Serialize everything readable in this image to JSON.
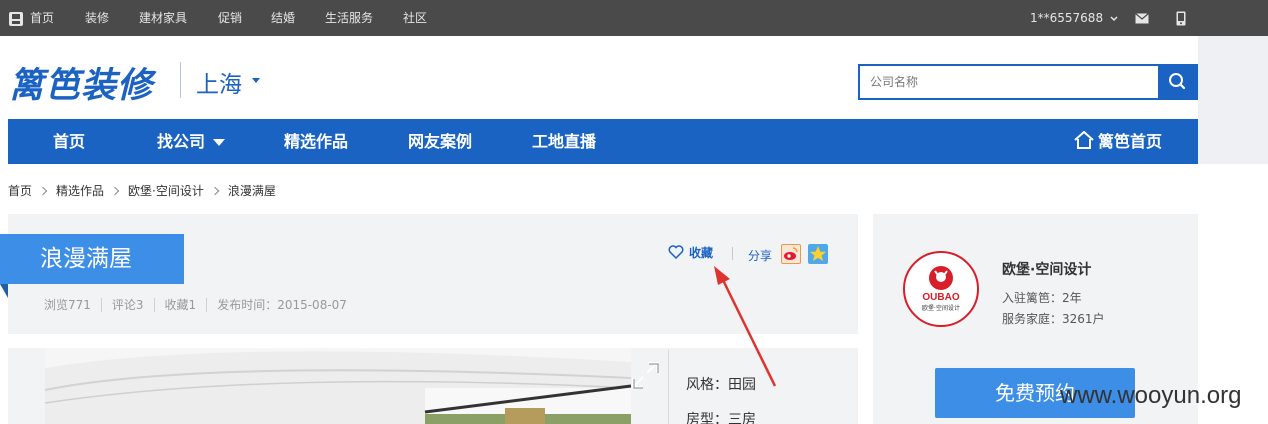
{
  "topbar": {
    "home": "首页",
    "links": [
      "装修",
      "建材家具",
      "促销",
      "结婚",
      "生活服务",
      "社区"
    ],
    "user": "1**6557688"
  },
  "header": {
    "logo": "篱笆装修",
    "city": "上海"
  },
  "search": {
    "placeholder": "公司名称"
  },
  "nav": {
    "items": [
      "首页",
      "找公司",
      "精选作品",
      "网友案例",
      "工地直播"
    ],
    "home_link": "篱笆首页"
  },
  "breadcrumb": [
    "首页",
    "精选作品",
    "欧堡·空间设计",
    "浪漫满屋"
  ],
  "work": {
    "title": "浪漫满屋",
    "favorite_label": "收藏",
    "share_label": "分享",
    "meta": {
      "views": "浏览771",
      "comments": "评论3",
      "favorites": "收藏1",
      "published": "发布时间：2015-08-07"
    },
    "attributes": {
      "style": "风格：田园",
      "layout": "房型：三房"
    }
  },
  "company": {
    "name": "欧堡·空间设计",
    "logo_text": "OUBAO",
    "logo_subtext": "欧堡·空间设计",
    "years": "入驻篱笆：2年",
    "households": "服务家庭：3261户",
    "book_button": "免费预约"
  },
  "watermark": "www.wooyun.org",
  "colors": {
    "brand_blue": "#1a63c3",
    "accent_blue": "#3d8ee6",
    "topbar": "#4a4a4a",
    "annotation_red": "#e0322f"
  }
}
